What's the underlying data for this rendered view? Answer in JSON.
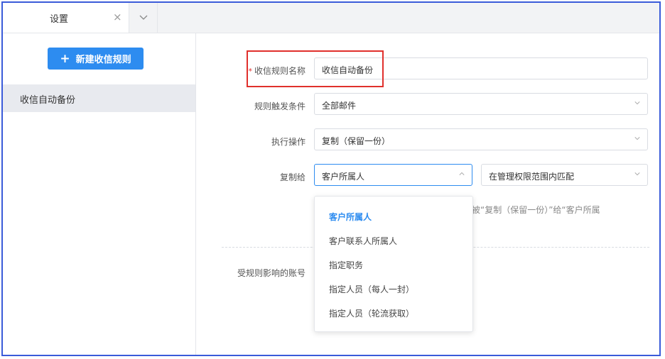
{
  "tab": {
    "title": "设置",
    "close": "×"
  },
  "sidebar": {
    "new_button_icon": "+",
    "new_button_label": "新建收信规则",
    "items": [
      {
        "label": "收信自动备份"
      }
    ]
  },
  "form": {
    "required_mark": "*",
    "rule_name": {
      "label": "收信规则名称",
      "value": "收信自动备份"
    },
    "trigger": {
      "label": "规则触发条件",
      "value": "全部邮件"
    },
    "action": {
      "label": "执行操作",
      "value": "复制（保留一份）"
    },
    "copy_to": {
      "label": "复制给",
      "value": "客户所属人",
      "scope_value": "在管理权限范围内匹配"
    },
    "hint_text": "将被“复制（保留一份）”给“客户所属",
    "accounts_label": "受规则影响的账号"
  },
  "dropdown": {
    "options": [
      "客户所属人",
      "客户联系人所属人",
      "指定职务",
      "指定人员（每人一封）",
      "指定人员（轮流获取）"
    ],
    "selected": "客户所属人"
  },
  "colors": {
    "accent": "#2d8cf0",
    "highlight_box": "#e0302c",
    "frame": "#3a5bd9"
  }
}
